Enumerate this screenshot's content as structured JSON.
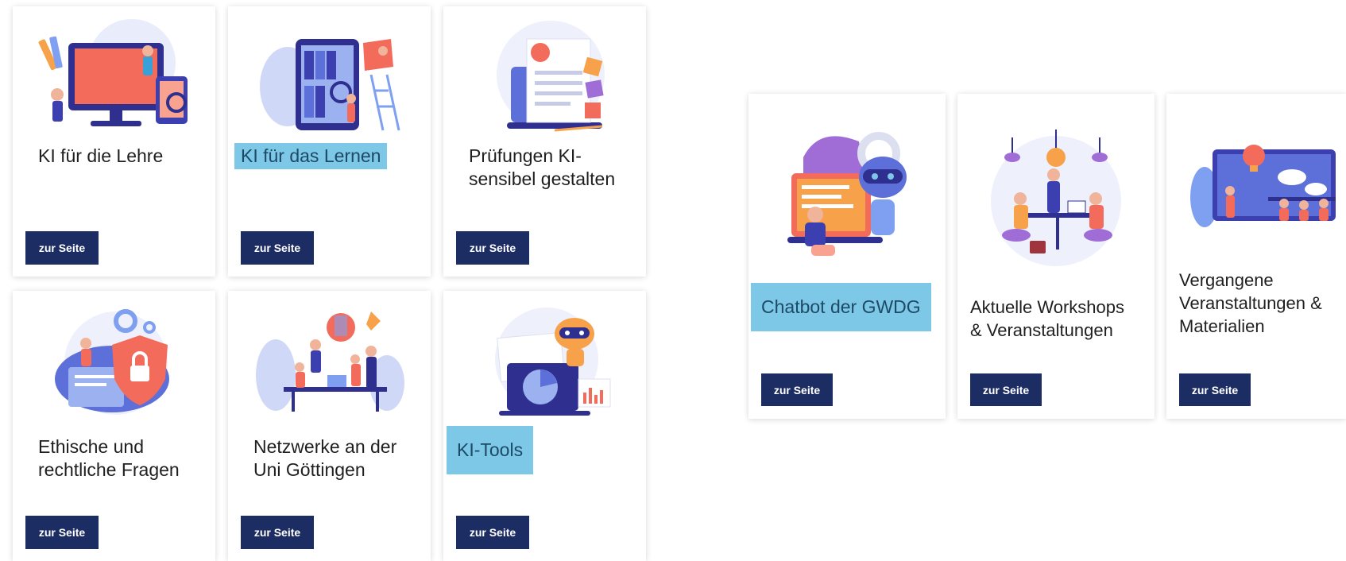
{
  "left_grid": [
    {
      "title_lines": [
        "KI für die Lehre"
      ],
      "highlighted": false,
      "button": "zur Seite",
      "illustration": "teacher-computer-illustration"
    },
    {
      "title_lines": [
        "KI für das Lernen"
      ],
      "highlighted": true,
      "button": "zur Seite",
      "illustration": "tablet-library-illustration"
    },
    {
      "title_lines": [
        "Prüfungen KI-",
        "sensibel gestalten"
      ],
      "highlighted": false,
      "button": "zur Seite",
      "illustration": "exam-laptop-illustration"
    },
    {
      "title_lines": [
        "Ethische und",
        "rechtliche Fragen"
      ],
      "highlighted": false,
      "button": "zur Seite",
      "illustration": "security-shield-illustration"
    },
    {
      "title_lines": [
        "Netzwerke an der",
        "Uni Göttingen"
      ],
      "highlighted": false,
      "button": "zur Seite",
      "illustration": "team-network-illustration"
    },
    {
      "title_lines": [
        "KI-Tools"
      ],
      "highlighted": true,
      "button": "zur Seite",
      "illustration": "robot-laptop-illustration"
    }
  ],
  "right_row": [
    {
      "title_lines": [
        "Chatbot der GWDG"
      ],
      "highlighted": true,
      "button": "zur Seite",
      "illustration": "chatbot-robot-illustration"
    },
    {
      "title_lines": [
        "Aktuelle Workshops",
        "& Veranstaltungen"
      ],
      "highlighted": false,
      "button": "zur Seite",
      "illustration": "workshop-meeting-illustration"
    },
    {
      "title_lines": [
        "Vergangene",
        "Veranstaltungen &",
        "Materialien"
      ],
      "highlighted": false,
      "button": "zur Seite",
      "illustration": "presentation-audience-illustration"
    }
  ],
  "colors": {
    "button_bg": "#1c2d63",
    "highlight_bg": "#7ec8e7",
    "card_bg": "#ffffff"
  }
}
